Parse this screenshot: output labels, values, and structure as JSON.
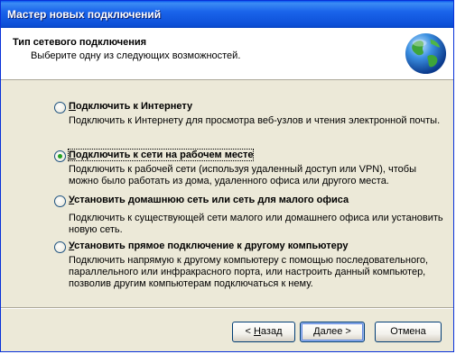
{
  "window": {
    "title": "Мастер новых подключений"
  },
  "header": {
    "title": "Тип сетевого подключения",
    "subtitle": "Выберите одну из следующих возможностей."
  },
  "options": [
    {
      "label_ul": "П",
      "label_rest": "одключить к Интернету",
      "selected": false,
      "description": "Подключить к Интернету для просмотра веб-узлов и чтения  электронной почты."
    },
    {
      "label_ul": "П",
      "label_rest": "одключить к сети на рабочем месте",
      "selected": true,
      "description": "Подключить к рабочей сети (используя удаленный доступ или VPN), чтобы можно было работать из дома, удаленного офиса или другого места."
    },
    {
      "label_ul": "У",
      "label_rest": "становить домашнюю сеть или сеть для малого офиса",
      "selected": false,
      "description": "Подключить к существующей сети малого или домашнего офиса или установить новую сеть."
    },
    {
      "label_ul": "У",
      "label_rest": "становить прямое подключение к другому компьютеру",
      "selected": false,
      "description": "Подключить напрямую к другому компьютеру с помощью последовательного, параллельного или инфракрасного порта, или настроить данный компьютер, позволив другим  компьютерам подключаться к нему."
    }
  ],
  "buttons": {
    "back_prefix": "< ",
    "back_ul": "Н",
    "back_rest": "азад",
    "next_ul": "Д",
    "next_rest": "алее >",
    "cancel": "Отмена"
  },
  "icons": {
    "header_icon": "globe-icon"
  }
}
